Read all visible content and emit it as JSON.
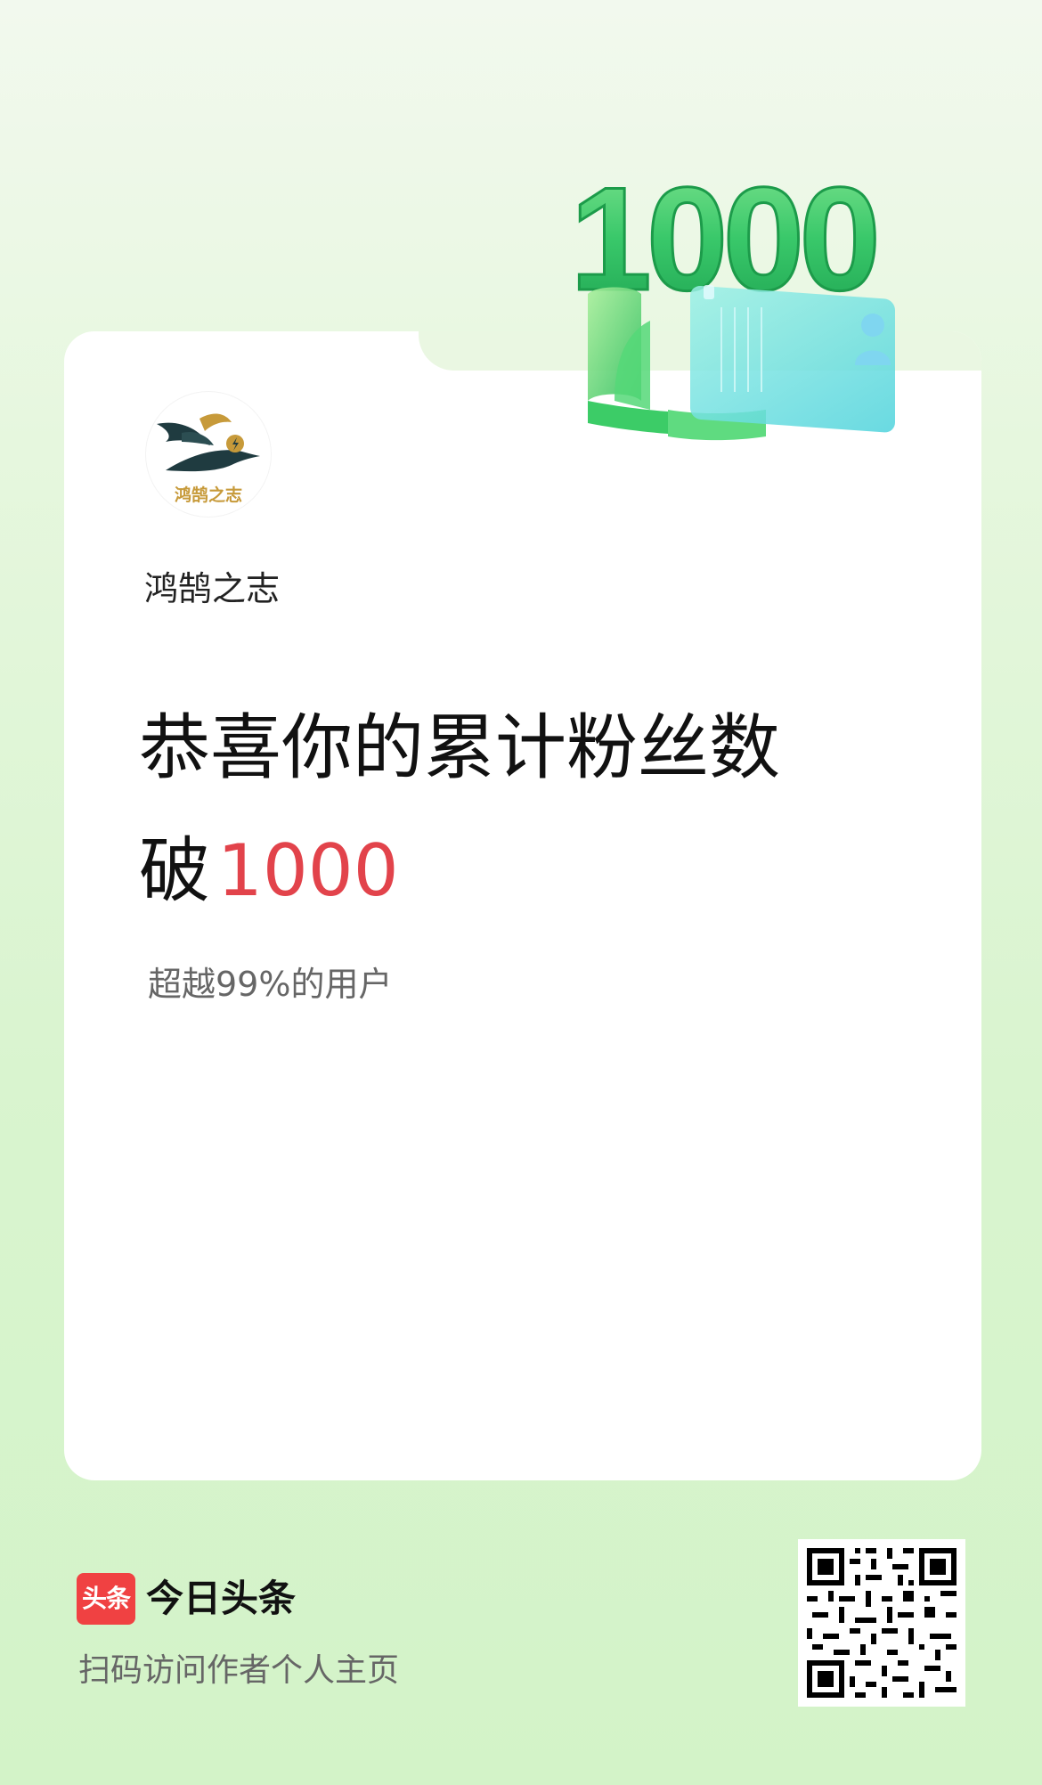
{
  "badge": {
    "number": "1000"
  },
  "author": {
    "logo_text": "鸿鹄之志",
    "name": "鸿鹄之志"
  },
  "headline": {
    "line1": "恭喜你的累计粉丝数",
    "line2_prefix": "破",
    "milestone": "1000"
  },
  "subline": "超越99%的用户",
  "footer": {
    "brand_logo_text": "头条",
    "brand_name": "今日头条",
    "scan_hint": "扫码访问作者个人主页"
  },
  "colors": {
    "accent_red": "#e2434b",
    "brand_red": "#f04142",
    "badge_green": "#39c86a",
    "background_green": "#d9f4cf"
  },
  "icons": [
    "bird-logo-icon",
    "person-icon",
    "qr-code-icon"
  ]
}
